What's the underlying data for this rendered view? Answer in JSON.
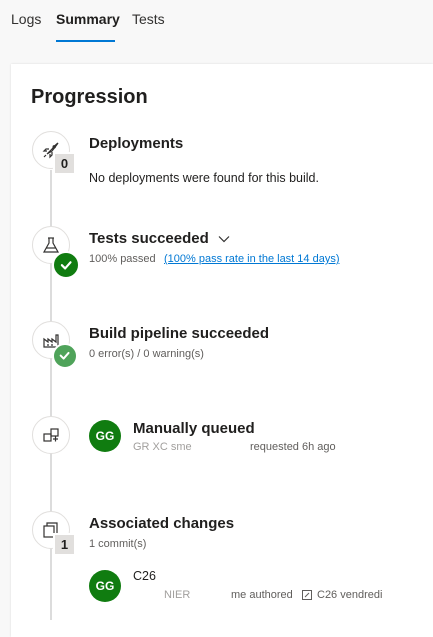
{
  "tabs": [
    {
      "label": "Logs"
    },
    {
      "label": "Summary",
      "active": true
    },
    {
      "label": "Tests"
    }
  ],
  "section_title": "Progression",
  "colors": {
    "accent": "#0078d4",
    "success": "#107c10",
    "success_light": "#4fa35a"
  },
  "steps": {
    "deployments": {
      "title": "Deployments",
      "count": "0",
      "body": "No deployments were found for this build.",
      "icon": "rocket-icon"
    },
    "tests": {
      "title": "Tests succeeded",
      "sub": "100% passed",
      "link": "(100% pass rate in the last 14 days)",
      "icon": "flask-icon"
    },
    "build": {
      "title": "Build pipeline succeeded",
      "sub": "0 error(s) / 0 warning(s)",
      "icon": "factory-icon"
    },
    "queued": {
      "title": "Manually queued",
      "avatar": "GG",
      "sub_faded": "GR        XC    sme",
      "sub": "requested 6h ago",
      "icon": "queue-icon"
    },
    "changes": {
      "title": "Associated changes",
      "count": "1",
      "sub": "1 commit(s)",
      "icon": "commits-icon",
      "commit": {
        "avatar": "GG",
        "title": "C26",
        "author_faded": "NIER",
        "author": "me authored",
        "ref": "C26 vendredi"
      }
    }
  }
}
